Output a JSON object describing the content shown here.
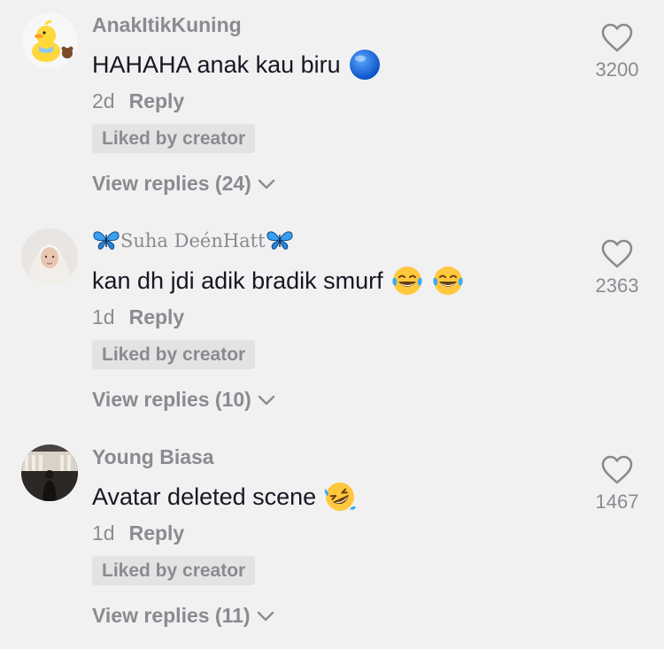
{
  "comments": [
    {
      "username": "AnakItikKuning",
      "text": "HAHAHA anak kau biru",
      "time": "2d",
      "reply_label": "Reply",
      "badge": "Liked by creator",
      "view_replies": "View replies (24)",
      "likes": "3200",
      "emoji": "blue-circle-emoji"
    },
    {
      "username": "Suha DeénHatt",
      "text": "kan dh jdi adik bradik smurf",
      "time": "1d",
      "reply_label": "Reply",
      "badge": "Liked by creator",
      "view_replies": "View replies (10)",
      "likes": "2363",
      "emoji": "tears-of-joy-emoji"
    },
    {
      "username": "Young Biasa",
      "text": "Avatar deleted scene",
      "time": "1d",
      "reply_label": "Reply",
      "badge": "Liked by creator",
      "view_replies": "View replies (11)",
      "likes": "1467",
      "emoji": "rolling-laughing-emoji"
    }
  ],
  "colors": {
    "background": "#f1f1f1",
    "primary_text": "#161823",
    "secondary_text": "#8a8b91",
    "badge_bg": "#e3e3e4"
  }
}
